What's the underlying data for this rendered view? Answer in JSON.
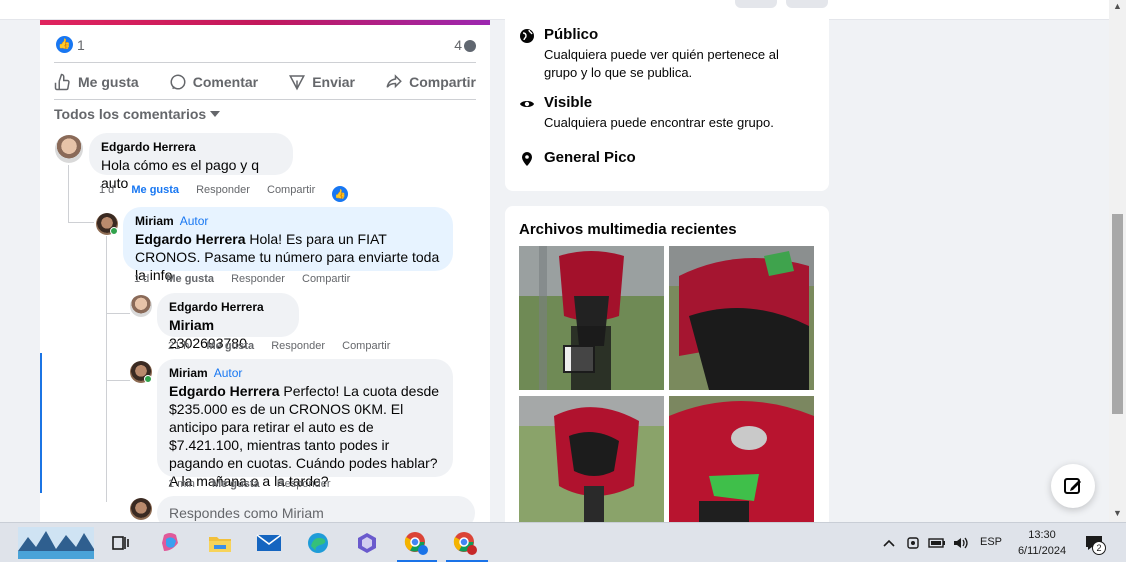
{
  "post": {
    "like_count": "1",
    "comment_count": "4",
    "actions": {
      "like": "Me gusta",
      "comment": "Comentar",
      "send": "Enviar",
      "share": "Compartir"
    },
    "sort_label": "Todos los comentarios"
  },
  "comments": [
    {
      "author": "Edgardo Herrera",
      "text": "Hola cómo es el pago y q auto",
      "time": "1 d",
      "like": "Me gusta",
      "reply": "Responder",
      "share": "Compartir"
    },
    {
      "author": "Miriam",
      "badge": "Autor",
      "mention": "Edgardo Herrera",
      "text": " Hola! Es para un FIAT CRONOS. Pasame tu número para enviarte toda la info",
      "time": "1 d",
      "like": "Me gusta",
      "reply": "Responder",
      "share": "Compartir"
    },
    {
      "author": "Edgardo Herrera",
      "mention": "Miriam",
      "text": " 2302693780",
      "time": "21 h",
      "like": "Me gusta",
      "reply": "Responder",
      "share": "Compartir"
    },
    {
      "author": "Miriam",
      "badge": "Autor",
      "mention": "Edgardo Herrera",
      "text": " Perfecto! La cuota desde $235.000 es de un CRONOS 0KM. El anticipo para retirar el auto es de $7.421.100, mientras tanto podes ir pagando en cuotas. Cuándo podes hablar? A la mañana o a la tarde?",
      "time": "1 min",
      "like": "Me gusta",
      "reply": "Responder"
    }
  ],
  "reply_placeholder": "Respondes como Miriam",
  "group_info": {
    "public_title": "Público",
    "public_desc": "Cualquiera puede ver quién pertenece al grupo y lo que se publica.",
    "visible_title": "Visible",
    "visible_desc": "Cualquiera puede encontrar este grupo.",
    "location": "General Pico"
  },
  "media": {
    "title": "Archivos multimedia recientes"
  },
  "taskbar": {
    "language": "ESP",
    "time": "13:30",
    "date": "6/11/2024",
    "notification_count": "2"
  },
  "colors": {
    "accent": "#1877f2",
    "online": "#31a24c",
    "moto_red": "#b3122e"
  }
}
